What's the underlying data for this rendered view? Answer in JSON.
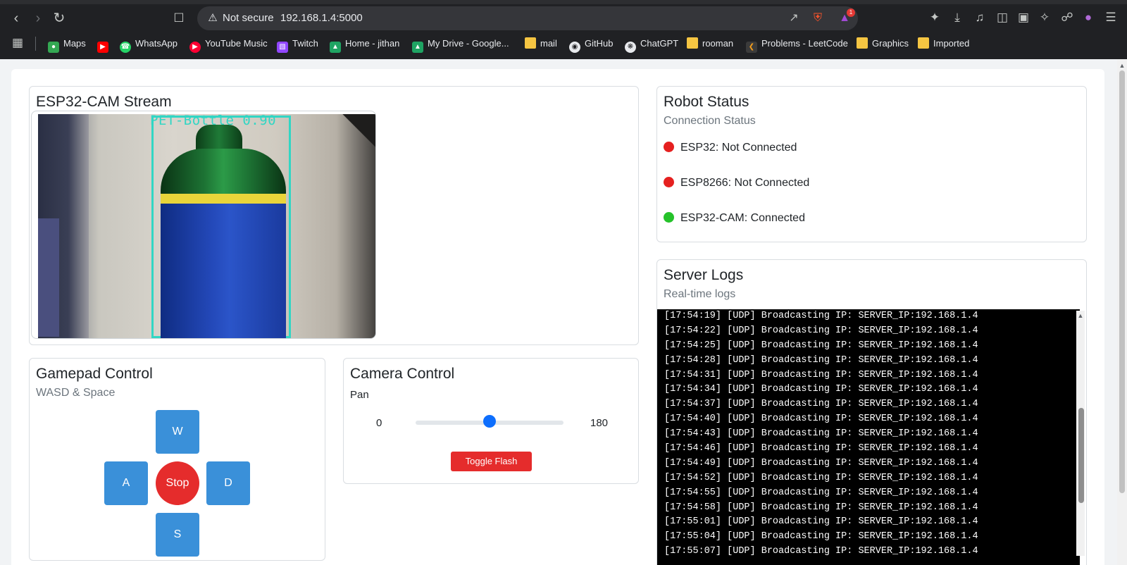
{
  "browser": {
    "security_label": "Not secure",
    "url": "192.168.1.4:5000",
    "rewards_badge": "1",
    "bookmarks": [
      "Maps",
      "WhatsApp",
      "YouTube Music",
      "Twitch",
      "Home - jithan",
      "My Drive - Google...",
      "mail",
      "GitHub",
      "ChatGPT",
      "rooman",
      "Problems - LeetCode",
      "Graphics",
      "Imported"
    ]
  },
  "stream": {
    "title": "ESP32-CAM Stream",
    "detection_label": "PET-Bottle 0.90",
    "detection_color": "#31d6c4"
  },
  "status": {
    "title": "Robot Status",
    "subtitle": "Connection Status",
    "items": [
      {
        "label": "ESP32: Not Connected",
        "color": "#e5201f"
      },
      {
        "label": "ESP8266: Not Connected",
        "color": "#e5201f"
      },
      {
        "label": "ESP32-CAM: Connected",
        "color": "#25c22a"
      }
    ]
  },
  "gamepad": {
    "title": "Gamepad Control",
    "subtitle": "WASD & Space",
    "up": "W",
    "left": "A",
    "stop": "Stop",
    "right": "D",
    "down": "S"
  },
  "camera": {
    "title": "Camera Control",
    "pan_label": "Pan",
    "min": "0",
    "max": "180",
    "pan_value": 90,
    "flash_button": "Toggle Flash"
  },
  "logs": {
    "title": "Server Logs",
    "subtitle": "Real-time logs",
    "lines": [
      "[17:54:19] [UDP] Broadcasting IP: SERVER_IP:192.168.1.4",
      "[17:54:22] [UDP] Broadcasting IP: SERVER_IP:192.168.1.4",
      "[17:54:25] [UDP] Broadcasting IP: SERVER_IP:192.168.1.4",
      "[17:54:28] [UDP] Broadcasting IP: SERVER_IP:192.168.1.4",
      "[17:54:31] [UDP] Broadcasting IP: SERVER_IP:192.168.1.4",
      "[17:54:34] [UDP] Broadcasting IP: SERVER_IP:192.168.1.4",
      "[17:54:37] [UDP] Broadcasting IP: SERVER_IP:192.168.1.4",
      "[17:54:40] [UDP] Broadcasting IP: SERVER_IP:192.168.1.4",
      "[17:54:43] [UDP] Broadcasting IP: SERVER_IP:192.168.1.4",
      "[17:54:46] [UDP] Broadcasting IP: SERVER_IP:192.168.1.4",
      "[17:54:49] [UDP] Broadcasting IP: SERVER_IP:192.168.1.4",
      "[17:54:52] [UDP] Broadcasting IP: SERVER_IP:192.168.1.4",
      "[17:54:55] [UDP] Broadcasting IP: SERVER_IP:192.168.1.4",
      "[17:54:58] [UDP] Broadcasting IP: SERVER_IP:192.168.1.4",
      "[17:55:01] [UDP] Broadcasting IP: SERVER_IP:192.168.1.4",
      "[17:55:04] [UDP] Broadcasting IP: SERVER_IP:192.168.1.4",
      "[17:55:07] [UDP] Broadcasting IP: SERVER_IP:192.168.1.4"
    ]
  },
  "colors": {
    "primary_button": "#3a90d9",
    "danger_button": "#e52c2c",
    "slider_thumb": "#0d6efd"
  }
}
